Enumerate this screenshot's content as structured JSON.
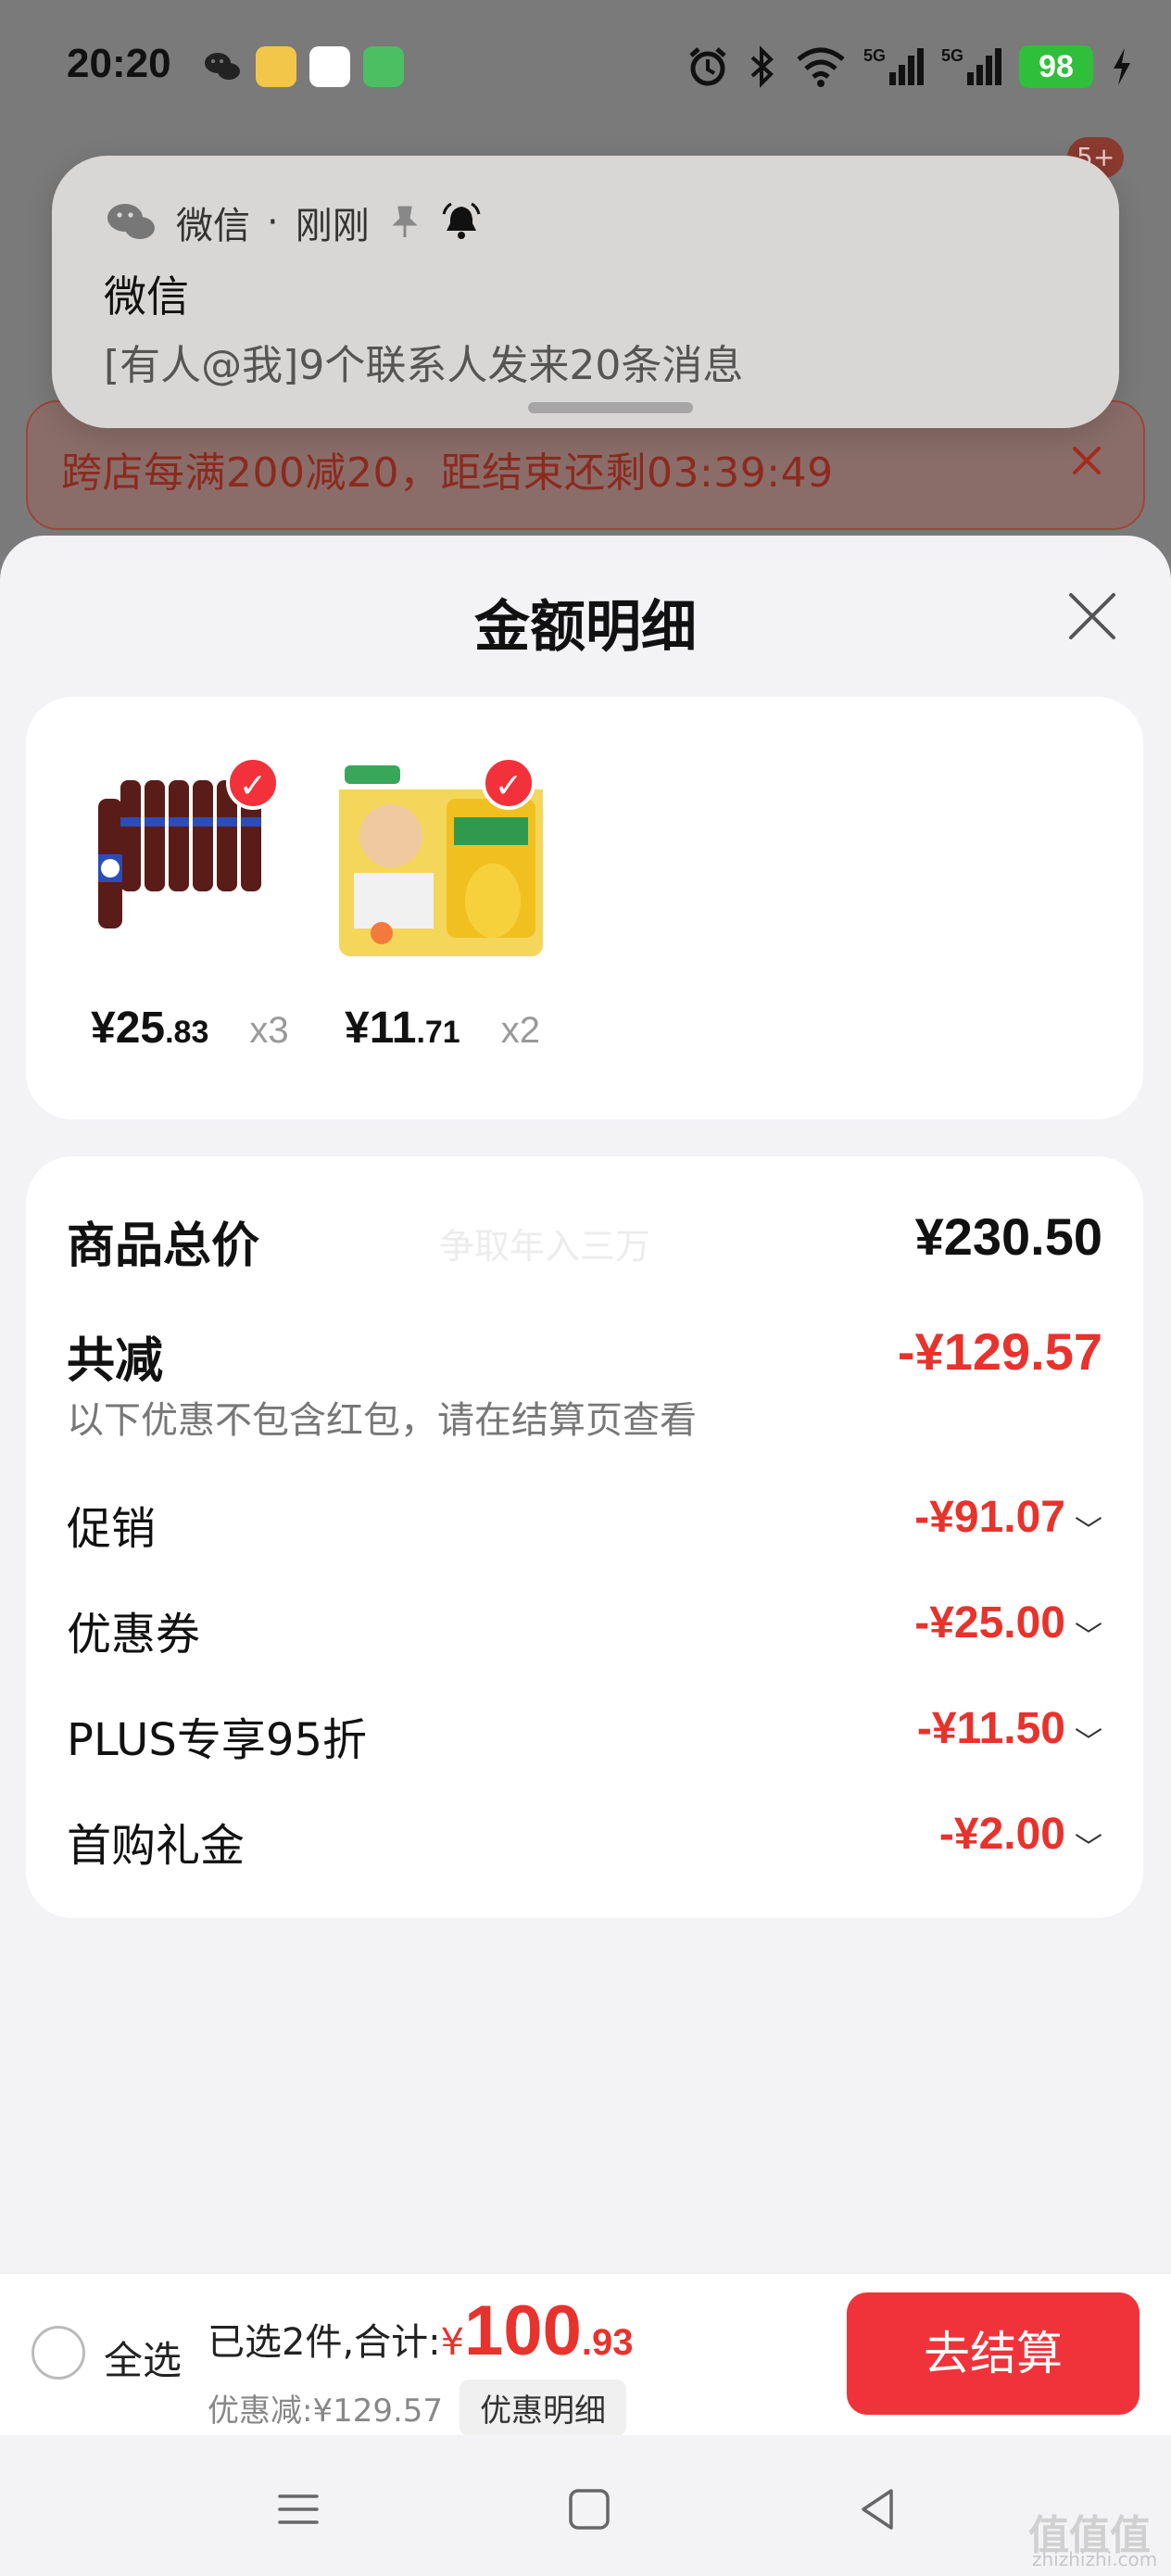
{
  "status_bar": {
    "time": "20:20",
    "battery": "98",
    "network": "5G"
  },
  "background": {
    "badge": "5+",
    "promo_banner": "跨店每满200减20，距结束还剩03:39:49"
  },
  "notification": {
    "app": "微信",
    "separator": "·",
    "time": "刚刚",
    "title": "微信",
    "body": "[有人@我]9个联系人发来20条消息"
  },
  "sheet": {
    "title": "金额明细",
    "products": [
      {
        "price_int": "¥25",
        "price_frac": ".83",
        "qty": "x3",
        "icon": "cola-bottles-image"
      },
      {
        "price_int": "¥11",
        "price_frac": ".71",
        "qty": "x2",
        "icon": "rice-bag-image"
      }
    ],
    "summary": {
      "total_label": "商品总价",
      "total_value": "¥230.50",
      "watermark": "争取年入三万",
      "reduce_label": "共减",
      "reduce_value": "-¥129.57",
      "hint": "以下优惠不包含红包，请在结算页查看",
      "items": [
        {
          "label": "促销",
          "value": "-¥91.07"
        },
        {
          "label": "优惠券",
          "value": "-¥25.00"
        },
        {
          "label": "PLUS专享95折",
          "value": "-¥11.50"
        },
        {
          "label": "首购礼金",
          "value": "-¥2.00"
        }
      ]
    }
  },
  "bottom_bar": {
    "select_all": "全选",
    "selected_prefix": "已选2件,合计:",
    "currency": "¥",
    "total_int": "100",
    "total_frac": ".93",
    "discount": "优惠减:¥129.57",
    "detail_button": "优惠明细",
    "checkout": "去结算"
  },
  "watermark_site": {
    "mark": "值值值",
    "sub": "zhizhizhi.com"
  },
  "colors": {
    "accent_red": "#e8322c",
    "checkout_red": "#f0333a",
    "battery_green": "#2fbf3a"
  }
}
